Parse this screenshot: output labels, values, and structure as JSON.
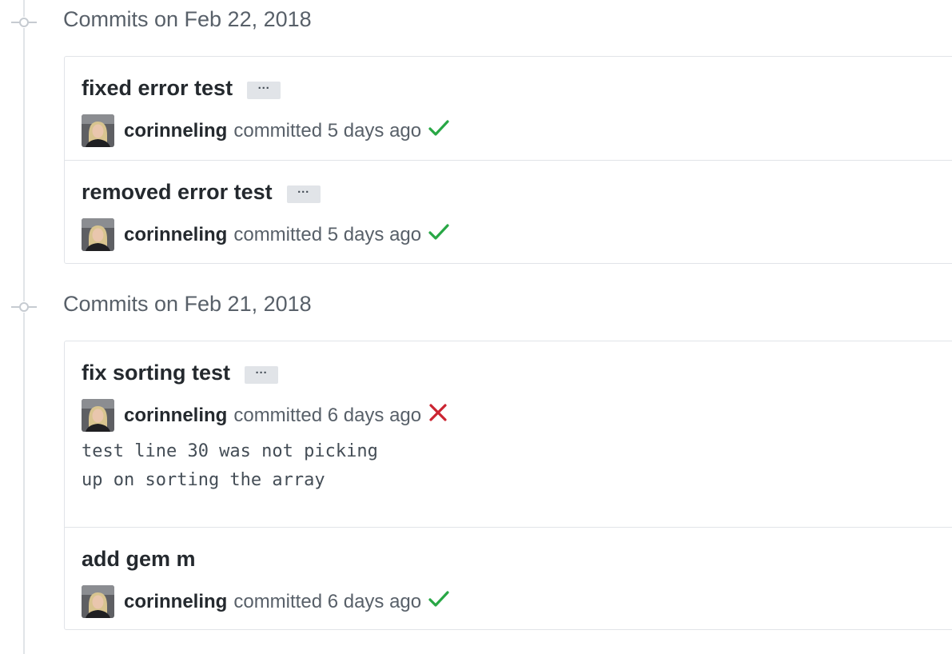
{
  "groups": [
    {
      "title": "Commits on Feb 22, 2018",
      "commits": [
        {
          "message": "fixed error test",
          "ellipsis": "···",
          "author": "corinneling",
          "committed": "committed 5 days ago",
          "status": "success"
        },
        {
          "message": "removed error test",
          "ellipsis": "···",
          "author": "corinneling",
          "committed": "committed 5 days ago",
          "status": "success"
        }
      ]
    },
    {
      "title": "Commits on Feb 21, 2018",
      "commits": [
        {
          "message": "fix sorting test",
          "ellipsis": "···",
          "author": "corinneling",
          "committed": "committed 6 days ago",
          "status": "failure",
          "description": "test line 30 was not picking\nup on sorting the array"
        },
        {
          "message": "add gem m",
          "author": "corinneling",
          "committed": "committed 6 days ago",
          "status": "success"
        }
      ]
    }
  ],
  "colors": {
    "success": "#28a745",
    "failure": "#cb2431",
    "timeline": "#e1e4e8",
    "muted_text": "#586069"
  },
  "icons": {
    "success": "check-icon",
    "failure": "x-icon",
    "node": "git-commit-icon"
  }
}
